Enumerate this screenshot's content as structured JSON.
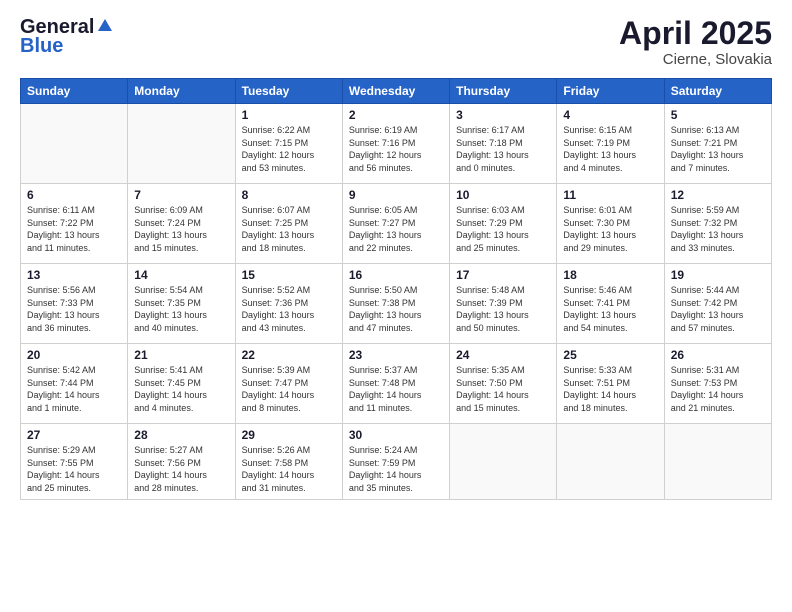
{
  "header": {
    "logo_line1": "General",
    "logo_line2": "Blue",
    "month": "April 2025",
    "location": "Cierne, Slovakia"
  },
  "weekdays": [
    "Sunday",
    "Monday",
    "Tuesday",
    "Wednesday",
    "Thursday",
    "Friday",
    "Saturday"
  ],
  "weeks": [
    [
      {
        "day": "",
        "info": ""
      },
      {
        "day": "",
        "info": ""
      },
      {
        "day": "1",
        "info": "Sunrise: 6:22 AM\nSunset: 7:15 PM\nDaylight: 12 hours\nand 53 minutes."
      },
      {
        "day": "2",
        "info": "Sunrise: 6:19 AM\nSunset: 7:16 PM\nDaylight: 12 hours\nand 56 minutes."
      },
      {
        "day": "3",
        "info": "Sunrise: 6:17 AM\nSunset: 7:18 PM\nDaylight: 13 hours\nand 0 minutes."
      },
      {
        "day": "4",
        "info": "Sunrise: 6:15 AM\nSunset: 7:19 PM\nDaylight: 13 hours\nand 4 minutes."
      },
      {
        "day": "5",
        "info": "Sunrise: 6:13 AM\nSunset: 7:21 PM\nDaylight: 13 hours\nand 7 minutes."
      }
    ],
    [
      {
        "day": "6",
        "info": "Sunrise: 6:11 AM\nSunset: 7:22 PM\nDaylight: 13 hours\nand 11 minutes."
      },
      {
        "day": "7",
        "info": "Sunrise: 6:09 AM\nSunset: 7:24 PM\nDaylight: 13 hours\nand 15 minutes."
      },
      {
        "day": "8",
        "info": "Sunrise: 6:07 AM\nSunset: 7:25 PM\nDaylight: 13 hours\nand 18 minutes."
      },
      {
        "day": "9",
        "info": "Sunrise: 6:05 AM\nSunset: 7:27 PM\nDaylight: 13 hours\nand 22 minutes."
      },
      {
        "day": "10",
        "info": "Sunrise: 6:03 AM\nSunset: 7:29 PM\nDaylight: 13 hours\nand 25 minutes."
      },
      {
        "day": "11",
        "info": "Sunrise: 6:01 AM\nSunset: 7:30 PM\nDaylight: 13 hours\nand 29 minutes."
      },
      {
        "day": "12",
        "info": "Sunrise: 5:59 AM\nSunset: 7:32 PM\nDaylight: 13 hours\nand 33 minutes."
      }
    ],
    [
      {
        "day": "13",
        "info": "Sunrise: 5:56 AM\nSunset: 7:33 PM\nDaylight: 13 hours\nand 36 minutes."
      },
      {
        "day": "14",
        "info": "Sunrise: 5:54 AM\nSunset: 7:35 PM\nDaylight: 13 hours\nand 40 minutes."
      },
      {
        "day": "15",
        "info": "Sunrise: 5:52 AM\nSunset: 7:36 PM\nDaylight: 13 hours\nand 43 minutes."
      },
      {
        "day": "16",
        "info": "Sunrise: 5:50 AM\nSunset: 7:38 PM\nDaylight: 13 hours\nand 47 minutes."
      },
      {
        "day": "17",
        "info": "Sunrise: 5:48 AM\nSunset: 7:39 PM\nDaylight: 13 hours\nand 50 minutes."
      },
      {
        "day": "18",
        "info": "Sunrise: 5:46 AM\nSunset: 7:41 PM\nDaylight: 13 hours\nand 54 minutes."
      },
      {
        "day": "19",
        "info": "Sunrise: 5:44 AM\nSunset: 7:42 PM\nDaylight: 13 hours\nand 57 minutes."
      }
    ],
    [
      {
        "day": "20",
        "info": "Sunrise: 5:42 AM\nSunset: 7:44 PM\nDaylight: 14 hours\nand 1 minute."
      },
      {
        "day": "21",
        "info": "Sunrise: 5:41 AM\nSunset: 7:45 PM\nDaylight: 14 hours\nand 4 minutes."
      },
      {
        "day": "22",
        "info": "Sunrise: 5:39 AM\nSunset: 7:47 PM\nDaylight: 14 hours\nand 8 minutes."
      },
      {
        "day": "23",
        "info": "Sunrise: 5:37 AM\nSunset: 7:48 PM\nDaylight: 14 hours\nand 11 minutes."
      },
      {
        "day": "24",
        "info": "Sunrise: 5:35 AM\nSunset: 7:50 PM\nDaylight: 14 hours\nand 15 minutes."
      },
      {
        "day": "25",
        "info": "Sunrise: 5:33 AM\nSunset: 7:51 PM\nDaylight: 14 hours\nand 18 minutes."
      },
      {
        "day": "26",
        "info": "Sunrise: 5:31 AM\nSunset: 7:53 PM\nDaylight: 14 hours\nand 21 minutes."
      }
    ],
    [
      {
        "day": "27",
        "info": "Sunrise: 5:29 AM\nSunset: 7:55 PM\nDaylight: 14 hours\nand 25 minutes."
      },
      {
        "day": "28",
        "info": "Sunrise: 5:27 AM\nSunset: 7:56 PM\nDaylight: 14 hours\nand 28 minutes."
      },
      {
        "day": "29",
        "info": "Sunrise: 5:26 AM\nSunset: 7:58 PM\nDaylight: 14 hours\nand 31 minutes."
      },
      {
        "day": "30",
        "info": "Sunrise: 5:24 AM\nSunset: 7:59 PM\nDaylight: 14 hours\nand 35 minutes."
      },
      {
        "day": "",
        "info": ""
      },
      {
        "day": "",
        "info": ""
      },
      {
        "day": "",
        "info": ""
      }
    ]
  ]
}
